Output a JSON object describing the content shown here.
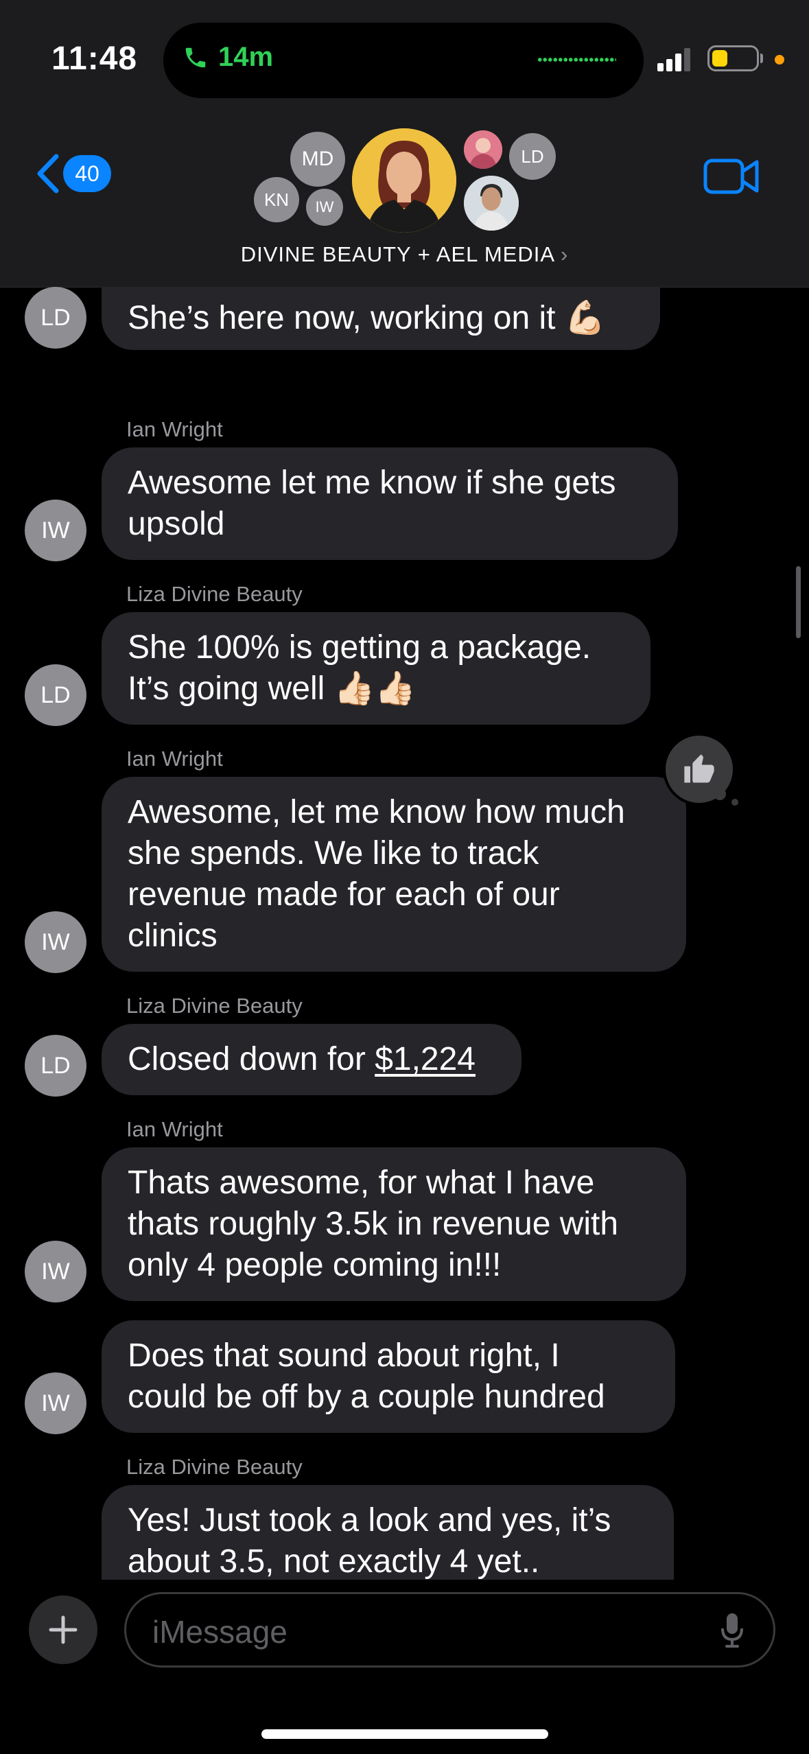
{
  "status_bar": {
    "time": "11:48",
    "call_duration": "14m"
  },
  "header": {
    "back_count": "40",
    "group_name": "DIVINE BEAUTY + AEL MEDIA",
    "avatars": [
      "MD",
      "KN",
      "IW",
      "LD"
    ]
  },
  "messages": [
    {
      "sender": "",
      "avatar": "LD",
      "text": "She’s here now, working on it 💪🏻"
    },
    {
      "sender": "Ian Wright",
      "avatar": "IW",
      "text": "Awesome let me know if she gets\nupsold"
    },
    {
      "sender": "Liza Divine Beauty",
      "avatar": "LD",
      "text": "She 100% is getting a package.\nIt’s going well 👍🏻👍🏻"
    },
    {
      "sender": "Ian Wright",
      "avatar": "IW",
      "text": "Awesome, let me know how much\nshe spends. We like to track\nrevenue made for each of our\nclinics"
    },
    {
      "sender": "Liza Divine Beauty",
      "avatar": "LD",
      "text_prefix": "Closed down for ",
      "text_link": "$1,224"
    },
    {
      "sender": "Ian Wright",
      "avatar": "IW",
      "text": "Thats awesome, for what I have\nthats roughly 3.5k in revenue with\nonly 4 people coming in!!!"
    },
    {
      "sender": "",
      "avatar": "IW",
      "text": "Does that sound about right, I\ncould be off by a couple hundred"
    },
    {
      "sender": "Liza Divine Beauty",
      "avatar": "",
      "text": "Yes! Just took a look and yes, it’s\nabout 3.5, not exactly 4 yet.."
    }
  ],
  "composer": {
    "placeholder": "iMessage"
  },
  "colors": {
    "accent": "#0a84ff",
    "bubble": "#26252a",
    "call_green": "#30d158"
  }
}
